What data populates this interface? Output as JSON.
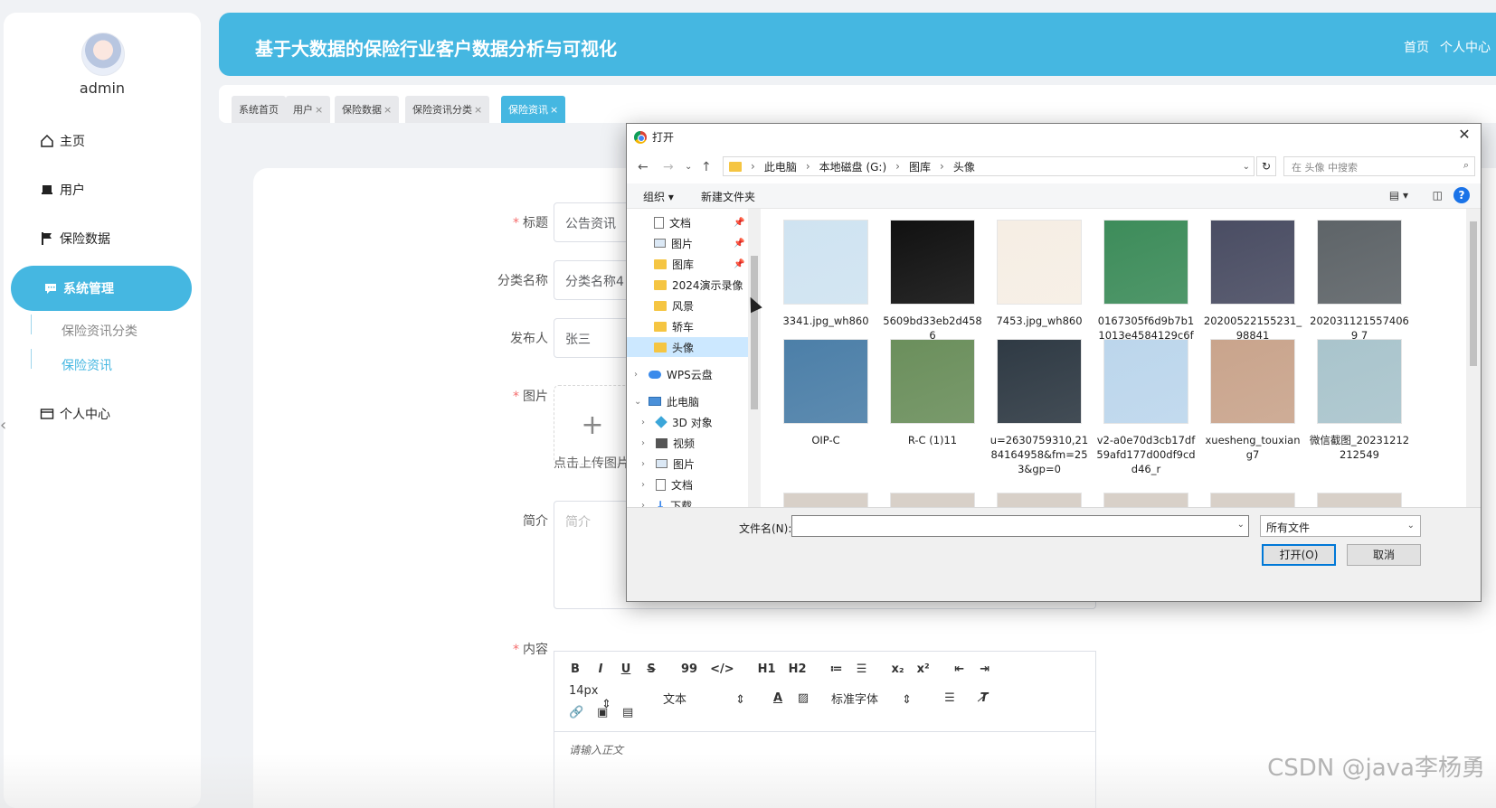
{
  "sidebar": {
    "username": "admin",
    "items": [
      {
        "label": "主页"
      },
      {
        "label": "用户"
      },
      {
        "label": "保险数据"
      },
      {
        "label": "系统管理"
      },
      {
        "label": "个人中心"
      }
    ],
    "sub_items": [
      {
        "label": "保险资讯分类"
      },
      {
        "label": "保险资讯"
      }
    ]
  },
  "header": {
    "title": "基于大数据的保险行业客户数据分析与可视化",
    "home_link": "首页",
    "profile_link": "个人中心"
  },
  "tabs": [
    {
      "label": "系统首页",
      "close": ""
    },
    {
      "label": "用户",
      "close": "×"
    },
    {
      "label": "保险数据",
      "close": "×"
    },
    {
      "label": "保险资讯分类",
      "close": "×"
    },
    {
      "label": "保险资讯",
      "close": "×"
    }
  ],
  "form": {
    "title_label": "标题",
    "title_value": "公告资讯",
    "category_label": "分类名称",
    "category_value": "分类名称4",
    "publisher_label": "发布人",
    "publisher_value": "张三",
    "image_label": "图片",
    "upload_plus": "+",
    "upload_tip": "点击上传图片",
    "intro_label": "简介",
    "intro_placeholder": "简介",
    "content_label": "内容",
    "required_mark": "*"
  },
  "editor": {
    "row1": [
      "B",
      "I",
      "U",
      "S",
      "99",
      "</>",
      "H1",
      "H2",
      "≔",
      "☰",
      "x₂",
      "x²",
      "⇤",
      "⇥"
    ],
    "font_size": "14px",
    "header_select": "文本",
    "font_family": "标准字体",
    "placeholder": "请输入正文"
  },
  "dialog": {
    "title": "打开",
    "close": "✕",
    "path": [
      "此电脑",
      "本地磁盘 (G:)",
      "图库",
      "头像"
    ],
    "search_placeholder": "在 头像 中搜索",
    "organize": "组织 ▾",
    "new_folder": "新建文件夹",
    "help": "?",
    "tree": [
      {
        "label": "文档",
        "pinned": true
      },
      {
        "label": "图片",
        "pinned": true
      },
      {
        "label": "图库",
        "pinned": true
      },
      {
        "label": "2024演示录像",
        "pinned": false
      },
      {
        "label": "风景",
        "pinned": false
      },
      {
        "label": "轿车",
        "pinned": false
      },
      {
        "label": "头像",
        "pinned": false,
        "selected": true
      },
      {
        "label": "WPS云盘",
        "pinned": false
      },
      {
        "label": "此电脑",
        "pinned": false
      },
      {
        "label": "3D 对象",
        "pinned": false
      },
      {
        "label": "视频",
        "pinned": false
      },
      {
        "label": "图片",
        "pinned": false
      },
      {
        "label": "文档",
        "pinned": false
      },
      {
        "label": "下载",
        "pinned": false
      }
    ],
    "files": [
      {
        "name": "3341.jpg_wh860",
        "color": "#cfe3f1"
      },
      {
        "name": "5609bd33eb2d4586",
        "color": "#111111"
      },
      {
        "name": "7453.jpg_wh860",
        "color": "#f6eee4"
      },
      {
        "name": "0167305f6d9b7b11013e4584129c6f",
        "color": "#3d8c5a"
      },
      {
        "name": "20200522155231_98841",
        "color": "#4a4d63"
      },
      {
        "name": "2020311215574069 7",
        "color": "#5e6468"
      },
      {
        "name": "OIP-C",
        "color": "#4c7fa8"
      },
      {
        "name": "R-C (1)11",
        "color": "#6b8f5c"
      },
      {
        "name": "u=2630759310,2184164958&fm=253&gp=0",
        "color": "#2f3a44"
      },
      {
        "name": "v2-a0e70d3cb17df59afd177d00df9cdd46_r",
        "color": "#bcd6ec"
      },
      {
        "name": "xuesheng_touxiang7",
        "color": "#c9a48c"
      },
      {
        "name": "微信截图_20231212212549",
        "color": "#a9c4cc"
      }
    ],
    "filename_label": "文件名(N):",
    "filetype": "所有文件",
    "open_button": "打开(O)",
    "cancel_button": "取消"
  },
  "watermark": "CSDN @java李杨勇"
}
